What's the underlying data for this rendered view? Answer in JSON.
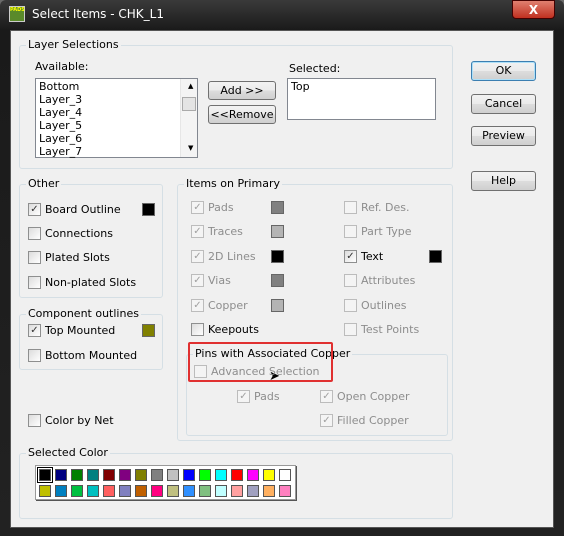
{
  "window": {
    "title": "Select Items - CHK_L1",
    "close_label": "X",
    "app_icon_text": "PADS"
  },
  "layer_selections": {
    "label": "Layer Selections",
    "available_label": "Available:",
    "available_items": [
      "Bottom",
      "Layer_3",
      "Layer_4",
      "Layer_5",
      "Layer_6",
      "Layer_7"
    ],
    "add_label": "Add >>",
    "remove_label": "<<Remove",
    "selected_label": "Selected:",
    "selected_items": [
      "Top"
    ]
  },
  "buttons": {
    "ok": "OK",
    "cancel": "Cancel",
    "preview": "Preview",
    "help": "Help"
  },
  "other": {
    "label": "Other",
    "items": [
      {
        "label": "Board Outline",
        "checked": true,
        "color": "#000000"
      },
      {
        "label": "Connections",
        "checked": false
      },
      {
        "label": "Plated Slots",
        "checked": false
      },
      {
        "label": "Non-plated Slots",
        "checked": false
      }
    ]
  },
  "component_outlines": {
    "label": "Component outlines",
    "items": [
      {
        "label": "Top Mounted",
        "checked": true,
        "color": "#808000"
      },
      {
        "label": "Bottom Mounted",
        "checked": false
      }
    ]
  },
  "color_by_net": {
    "label": "Color by Net",
    "checked": false
  },
  "items_on_primary": {
    "label": "Items on Primary",
    "left": [
      {
        "label": "Pads",
        "checked": true,
        "color": "#808080"
      },
      {
        "label": "Traces",
        "checked": true,
        "color": "#b4b4b4"
      },
      {
        "label": "2D Lines",
        "checked": true,
        "color": "#000000"
      },
      {
        "label": "Vias",
        "checked": true,
        "color": "#808080"
      },
      {
        "label": "Copper",
        "checked": true,
        "color": "#b4b4b4"
      },
      {
        "label": "Keepouts",
        "checked": false
      }
    ],
    "right": [
      {
        "label": "Ref. Des.",
        "checked": false
      },
      {
        "label": "Part Type",
        "checked": false
      },
      {
        "label": "Text",
        "checked": true,
        "color": "#000000"
      },
      {
        "label": "Attributes",
        "checked": false
      },
      {
        "label": "Outlines",
        "checked": false
      },
      {
        "label": "Test Points",
        "checked": false
      }
    ]
  },
  "pins_copper": {
    "label": "Pins with Associated Copper",
    "advanced": {
      "label": "Advanced Selection",
      "checked": false
    },
    "pads": {
      "label": "Pads",
      "checked": true
    },
    "open_copper": {
      "label": "Open Copper",
      "checked": true
    },
    "filled_copper": {
      "label": "Filled Copper",
      "checked": true
    }
  },
  "selected_color": {
    "label": "Selected Color",
    "selected": "#000000",
    "palette": [
      [
        "#000000",
        "#000080",
        "#008000",
        "#008080",
        "#800000",
        "#800080",
        "#808000",
        "#808080",
        "#c0c0c0",
        "#0000ff",
        "#00ff00",
        "#00ffff",
        "#ff0000",
        "#ff00ff",
        "#ffff00",
        "#ffffff"
      ],
      [
        "#c0c000",
        "#0080c0",
        "#00c040",
        "#00c0c0",
        "#ff6060",
        "#8080c0",
        "#c06000",
        "#ff0080",
        "#c0c080",
        "#3090ff",
        "#80c080",
        "#c0ffff",
        "#ffa0a0",
        "#a0a0c0",
        "#ffb060",
        "#ff80c0"
      ]
    ]
  }
}
